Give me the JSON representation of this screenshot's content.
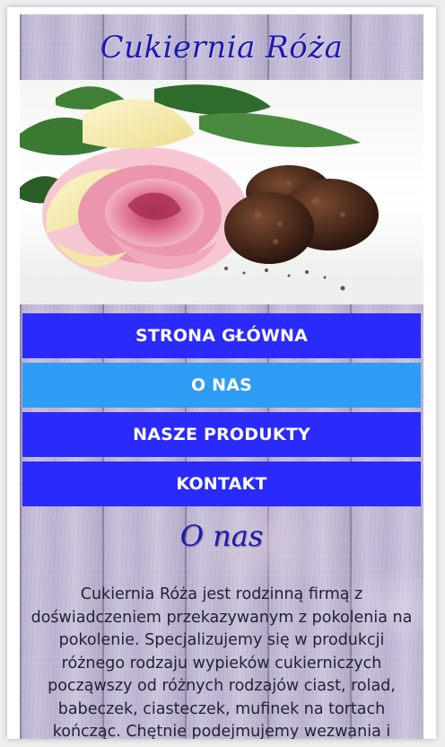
{
  "site": {
    "title": "Cukiernia Róża"
  },
  "hero": {
    "image": "rose-and-chocolate-pralines-photo"
  },
  "nav": {
    "items": [
      {
        "label": "STRONA GŁÓWNA",
        "active": false
      },
      {
        "label": "O NAS",
        "active": true
      },
      {
        "label": "NASZE PRODUKTY",
        "active": false
      },
      {
        "label": "KONTAKT",
        "active": false
      }
    ]
  },
  "about": {
    "title": "O nas",
    "text": "Cukiernia Róża jest rodzinną firmą z doświadczeniem przekazywanym z pokolenia na pokolenie. Specjalizujemy się w produkcji różnego rodzaju wypieków cukierniczych począwszy od różnych rodzajów ciast, rolad, babeczek, ciasteczek, mufinek na tortach kończąc. Chętnie podejmujemy wezwania i"
  },
  "colors": {
    "title": "#1d1ab0",
    "nav": "#2a2afb",
    "nav_active": "#2e9cf5",
    "wood": "#c4bbd6"
  }
}
